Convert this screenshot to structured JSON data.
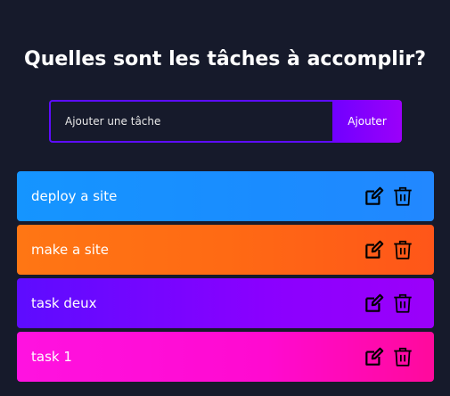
{
  "header": {
    "title": "Quelles sont les tâches à accomplir?"
  },
  "form": {
    "placeholder": "Ajouter une tâche",
    "value": "",
    "add_label": "Ajouter"
  },
  "todos": [
    {
      "text": "deploy a site",
      "color": "#1595ff"
    },
    {
      "text": "make a site",
      "color": "#ff7614"
    },
    {
      "text": "task deux",
      "color": "#5d0cff"
    },
    {
      "text": "task 1",
      "color": "#ff12e0"
    }
  ],
  "icons": {
    "edit": "edit-icon",
    "delete": "trash-icon"
  },
  "colors": {
    "background": "#161a2b",
    "accent": "#5d0cff"
  }
}
